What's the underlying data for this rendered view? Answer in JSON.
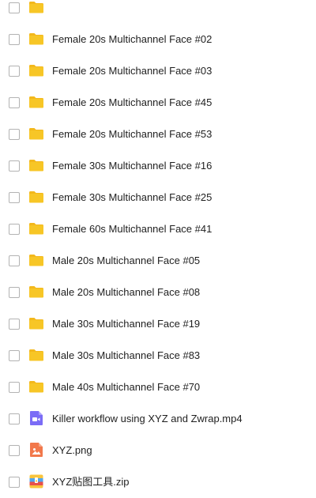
{
  "colors": {
    "folder": "#F7C626",
    "folder_tab": "#F3B81C",
    "video": "#7B6CF6",
    "image": "#F2784B",
    "zip_a": "#F9C43C",
    "zip_b": "#4FA6F0",
    "zip_c": "#E8504B"
  },
  "files": [
    {
      "name": "",
      "icon": "folder-icon"
    },
    {
      "name": "Female 20s Multichannel Face #02",
      "icon": "folder-icon"
    },
    {
      "name": "Female 20s Multichannel Face #03",
      "icon": "folder-icon"
    },
    {
      "name": "Female 20s Multichannel Face #45",
      "icon": "folder-icon"
    },
    {
      "name": "Female 20s Multichannel Face #53",
      "icon": "folder-icon"
    },
    {
      "name": "Female 30s Multichannel Face #16",
      "icon": "folder-icon"
    },
    {
      "name": "Female 30s Multichannel Face #25",
      "icon": "folder-icon"
    },
    {
      "name": "Female 60s Multichannel Face #41",
      "icon": "folder-icon"
    },
    {
      "name": "Male 20s Multichannel Face #05",
      "icon": "folder-icon"
    },
    {
      "name": "Male 20s Multichannel Face #08",
      "icon": "folder-icon"
    },
    {
      "name": "Male 30s Multichannel Face #19",
      "icon": "folder-icon"
    },
    {
      "name": "Male 30s Multichannel Face #83",
      "icon": "folder-icon"
    },
    {
      "name": "Male 40s Multichannel Face #70",
      "icon": "folder-icon"
    },
    {
      "name": "Killer workflow using XYZ and Zwrap.mp4",
      "icon": "video-file-icon"
    },
    {
      "name": "XYZ.png",
      "icon": "image-file-icon"
    },
    {
      "name": "XYZ贴图工具.zip",
      "icon": "zip-file-icon"
    }
  ]
}
